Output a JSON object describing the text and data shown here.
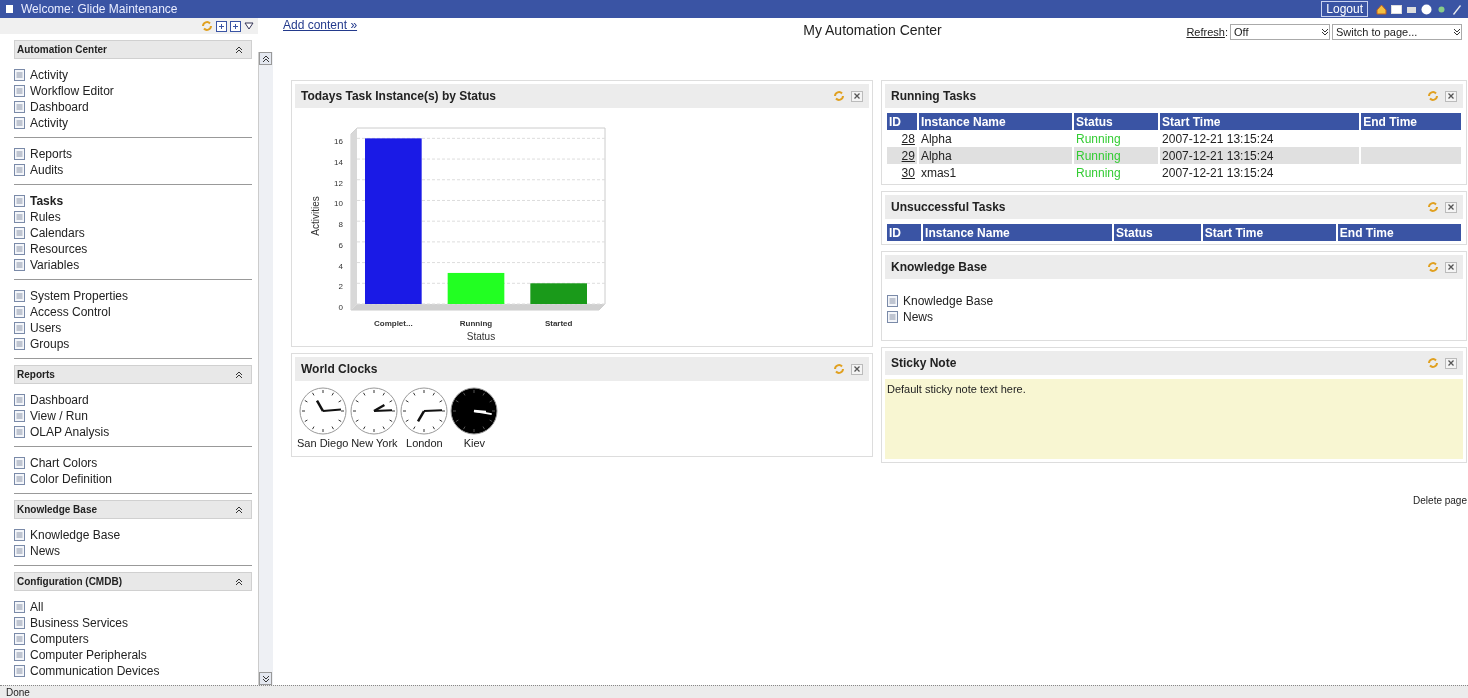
{
  "title_bar": {
    "title": "Welcome: Glide Maintenance",
    "logout": "Logout"
  },
  "sidebar": {
    "sections": [
      {
        "title": "Automation Center",
        "expanded": true,
        "groups": [
          {
            "items": [
              {
                "label": "Activity",
                "selected": false
              },
              {
                "label": "Workflow Editor",
                "selected": false
              },
              {
                "label": "Dashboard",
                "selected": false
              },
              {
                "label": "Activity",
                "selected": false
              }
            ]
          },
          {
            "items": [
              {
                "label": "Reports",
                "selected": false
              },
              {
                "label": "Audits",
                "selected": false
              }
            ]
          },
          {
            "items": [
              {
                "label": "Tasks",
                "selected": true
              },
              {
                "label": "Rules",
                "selected": false
              },
              {
                "label": "Calendars",
                "selected": false
              },
              {
                "label": "Resources",
                "selected": false
              },
              {
                "label": "Variables",
                "selected": false
              }
            ]
          },
          {
            "items": [
              {
                "label": "System Properties",
                "selected": false
              },
              {
                "label": "Access Control",
                "selected": false
              },
              {
                "label": "Users",
                "selected": false
              },
              {
                "label": "Groups",
                "selected": false
              }
            ]
          }
        ]
      },
      {
        "title": "Reports",
        "expanded": true,
        "groups": [
          {
            "items": [
              {
                "label": "Dashboard",
                "selected": false
              },
              {
                "label": "View / Run",
                "selected": false
              },
              {
                "label": "OLAP Analysis",
                "selected": false
              }
            ]
          },
          {
            "items": [
              {
                "label": "Chart Colors",
                "selected": false
              },
              {
                "label": "Color Definition",
                "selected": false
              }
            ]
          }
        ]
      },
      {
        "title": "Knowledge Base",
        "expanded": true,
        "groups": [
          {
            "items": [
              {
                "label": "Knowledge Base",
                "selected": false
              },
              {
                "label": "News",
                "selected": false
              }
            ]
          }
        ]
      },
      {
        "title": "Configuration (CMDB)",
        "expanded": true,
        "groups": [
          {
            "items": [
              {
                "label": "All",
                "selected": false
              },
              {
                "label": "Business Services",
                "selected": false
              },
              {
                "label": "Computers",
                "selected": false
              },
              {
                "label": "Computer Peripherals",
                "selected": false
              },
              {
                "label": "Communication Devices",
                "selected": false
              }
            ]
          }
        ]
      }
    ]
  },
  "header": {
    "add_content": "Add content »",
    "title": "My Automation Center",
    "refresh_label": "Refresh",
    "refresh_colon": ":",
    "refresh_value": "Off",
    "switch_page": "Switch to page..."
  },
  "task_chart": {
    "title": "Todays Task Instance(s) by Status",
    "chart_data": {
      "type": "bar",
      "ylabel": "Activities",
      "xlabel": "Status",
      "categories": [
        "Complet...",
        "Running",
        "Started"
      ],
      "values": [
        16,
        3,
        2
      ],
      "ylim": [
        0,
        17
      ],
      "grid": true,
      "yticks": [
        0,
        2,
        4,
        6,
        8,
        10,
        12,
        14,
        16
      ]
    }
  },
  "world_clocks": {
    "title": "World Clocks",
    "clocks": [
      {
        "city": "San Diego",
        "night": false
      },
      {
        "city": "New York",
        "night": false
      },
      {
        "city": "London",
        "night": false
      },
      {
        "city": "Kiev",
        "night": true
      }
    ]
  },
  "running_tasks": {
    "title": "Running Tasks",
    "columns": [
      "ID",
      "Instance Name",
      "Status",
      "Start Time",
      "End Time"
    ],
    "rows": [
      {
        "id": "28",
        "name": "Alpha",
        "status": "Running",
        "start": "2007-12-21 13:15:24"
      },
      {
        "id": "29",
        "name": "Alpha",
        "status": "Running",
        "start": "2007-12-21 13:15:24"
      },
      {
        "id": "30",
        "name": "xmas1",
        "status": "Running",
        "start": "2007-12-21 13:15:24"
      }
    ]
  },
  "unsuccessful_tasks": {
    "title": "Unsuccessful Tasks",
    "columns": [
      "ID",
      "Instance Name",
      "Status",
      "Start Time",
      "End Time"
    ]
  },
  "knowledge_base": {
    "title": "Knowledge Base",
    "links": [
      "Knowledge Base",
      "News"
    ]
  },
  "sticky_note": {
    "title": "Sticky Note",
    "text": "Default sticky note text here."
  },
  "delete_page": "Delete page",
  "status_bar": {
    "text": "Done"
  }
}
